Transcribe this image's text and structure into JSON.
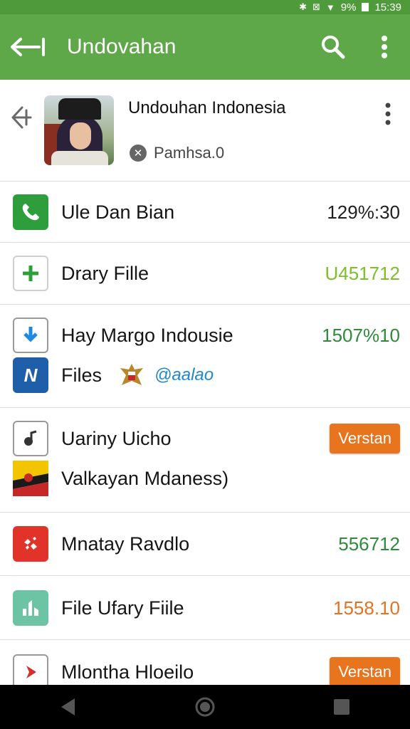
{
  "status_bar": {
    "battery": "9%",
    "time": "15:39"
  },
  "app_bar": {
    "title": "Undovahan"
  },
  "header": {
    "title": "Undouhan Indonesia",
    "subtitle": "Pamhsa.0"
  },
  "rows": [
    {
      "label": "Ule Dan Bian",
      "value": "129%:30",
      "value_color": "#1f1f1f",
      "icon": "phone-icon",
      "icon_bg": "#2e9e3d"
    },
    {
      "label": "Drary Fille",
      "value": "U451712",
      "value_color": "#7cbf2a",
      "icon": "plus-icon",
      "icon_bg": "#ffffff"
    },
    {
      "label": "Hay Margo Indousie",
      "value": "1507%10",
      "value_color": "#2e8b3a",
      "icon": "download-icon",
      "icon_bg": "#ffffff",
      "sub": {
        "label": "Files",
        "tag": "@aalao",
        "icon": "n-app-icon",
        "emblem": "garuda-emblem-icon"
      }
    },
    {
      "label": "Uariny Uicho",
      "button": "Verstan",
      "icon": "music-note-icon",
      "icon_bg": "#ffffff",
      "sub": {
        "label": "Valkayan Mdaness)",
        "icon": "flag-icon"
      }
    },
    {
      "label": "Mnatay Ravdlo",
      "value": "556712",
      "value_color": "#2e8b3a",
      "icon": "puzzle-icon",
      "icon_bg": "#e2332b"
    },
    {
      "label": "File Ufary Fiile",
      "value": "1558.10",
      "value_color": "#e3731e",
      "icon": "chart-icon",
      "icon_bg": "#6cc4a4"
    },
    {
      "label": "Mlontha Hloeilo",
      "button": "Verstan",
      "icon": "play-icon",
      "icon_bg": "#ffffff"
    }
  ]
}
